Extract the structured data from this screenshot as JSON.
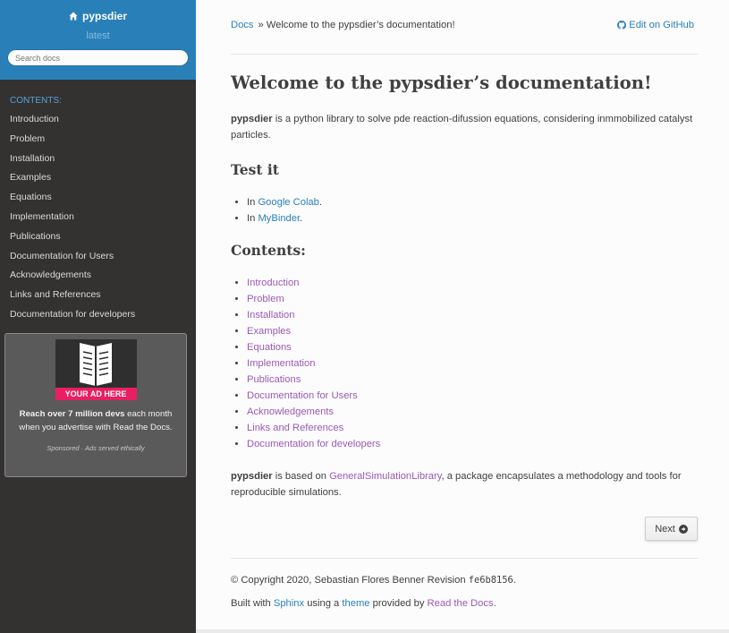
{
  "sidebar": {
    "project": "pypsdier",
    "version": "latest",
    "search_placeholder": "Search docs",
    "caption": "CONTENTS:",
    "items": [
      {
        "label": "Introduction"
      },
      {
        "label": "Problem"
      },
      {
        "label": "Installation"
      },
      {
        "label": "Examples"
      },
      {
        "label": "Equations"
      },
      {
        "label": "Implementation"
      },
      {
        "label": "Publications"
      },
      {
        "label": "Documentation for Users"
      },
      {
        "label": "Acknowledgements"
      },
      {
        "label": "Links and References"
      },
      {
        "label": "Documentation for developers"
      }
    ],
    "ad": {
      "banner": "YOUR AD HERE",
      "text_bold": "Reach over 7 million devs",
      "text_rest": " each month when you advertise with Read the Docs.",
      "footer": "Sponsored · Ads served ethically"
    }
  },
  "breadcrumbs": {
    "root": "Docs",
    "separator": "»",
    "current": "Welcome to the pypsdier’s documentation!",
    "edit": "Edit on GitHub"
  },
  "content": {
    "title": "Welcome to the pypsdier’s documentation!",
    "intro_bold": "pypsdier",
    "intro_rest": " is a python library to solve pde reaction-difussion equations, considering inmmobilized catalyst particles.",
    "test_heading": "Test it",
    "test_items": [
      {
        "prefix": "In ",
        "link": "Google Colab",
        "suffix": "."
      },
      {
        "prefix": "In ",
        "link": "MyBinder",
        "suffix": "."
      }
    ],
    "contents_heading": "Contents:",
    "contents_items": [
      {
        "label": "Introduction"
      },
      {
        "label": "Problem"
      },
      {
        "label": "Installation"
      },
      {
        "label": "Examples"
      },
      {
        "label": "Equations"
      },
      {
        "label": "Implementation"
      },
      {
        "label": "Publications"
      },
      {
        "label": "Documentation for Users"
      },
      {
        "label": "Acknowledgements"
      },
      {
        "label": "Links and References"
      },
      {
        "label": "Documentation for developers"
      }
    ],
    "based_bold": "pypsdier",
    "based_pre": " is based on ",
    "based_link": "GeneralSimulationLibrary",
    "based_rest": ", a package encapsulates a methodology and tools for reproducible simulations.",
    "next_label": "Next"
  },
  "footer": {
    "copyright": "© Copyright 2020, Sebastian Flores Benner Revision ",
    "revision": "fe6b8156",
    "copyright_end": ".",
    "built_pre": "Built with ",
    "sphinx": "Sphinx",
    "built_mid": " using a ",
    "theme": "theme",
    "built_mid2": " provided by ",
    "rtd": "Read the Docs",
    "built_end": "."
  }
}
